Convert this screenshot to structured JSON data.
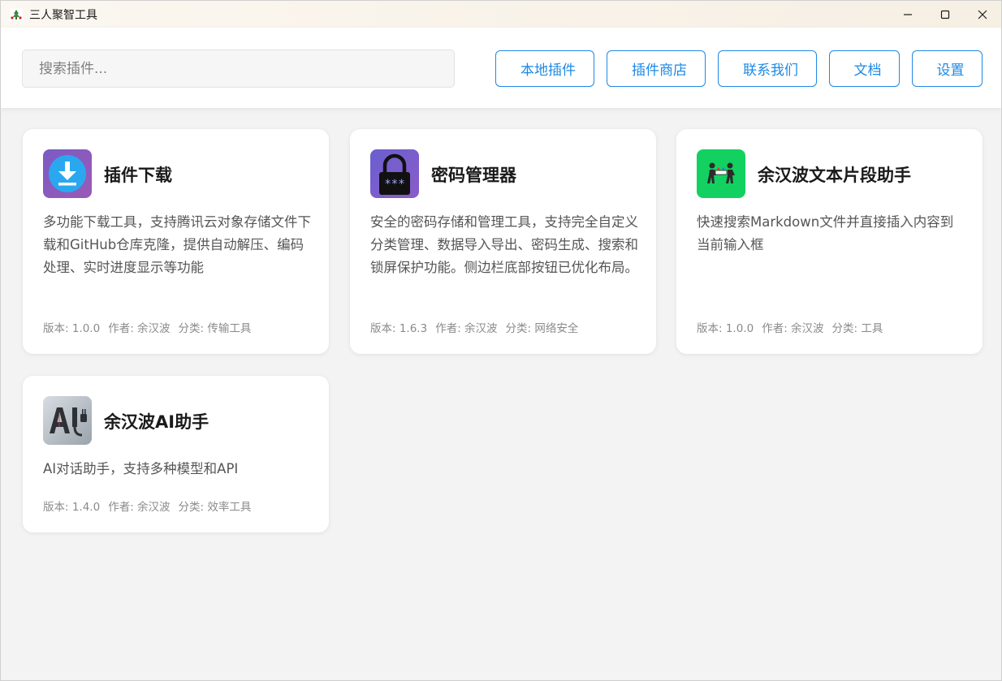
{
  "window": {
    "title": "三人聚智工具",
    "icon": "app-logo-icon"
  },
  "header": {
    "search": {
      "placeholder": "搜索插件...",
      "value": ""
    },
    "nav": {
      "local_plugins": "本地插件",
      "plugin_store": "插件商店",
      "contact_us": "联系我们",
      "docs": "文档",
      "settings": "设置"
    },
    "accent_color": "#1e88e5"
  },
  "plugins": [
    {
      "name": "插件下载",
      "icon": "download-icon",
      "description": "多功能下载工具，支持腾讯云对象存储文件下载和GitHub仓库克隆，提供自动解压、编码处理、实时进度显示等功能",
      "version": "版本: 1.0.0",
      "author": "作者: 余汉波",
      "category": "分类: 传输工具"
    },
    {
      "name": "密码管理器",
      "icon": "padlock-icon",
      "description": "安全的密码存储和管理工具，支持完全自定义分类管理、数据导入导出、密码生成、搜索和锁屏保护功能。侧边栏底部按钮已优化布局。",
      "version": "版本: 1.6.3",
      "author": "作者: 余汉波",
      "category": "分类: 网络安全"
    },
    {
      "name": "余汉波文本片段助手",
      "icon": "people-carrying-icon",
      "description": "快速搜索Markdown文件并直接插入内容到当前输入框",
      "version": "版本: 1.0.0",
      "author": "作者: 余汉波",
      "category": "分类: 工具"
    },
    {
      "name": "余汉波AI助手",
      "icon": "ai-plug-icon",
      "description": "AI对话助手，支持多种模型和API",
      "version": "版本: 1.4.0",
      "author": "作者: 余汉波",
      "category": "分类: 效率工具"
    }
  ]
}
